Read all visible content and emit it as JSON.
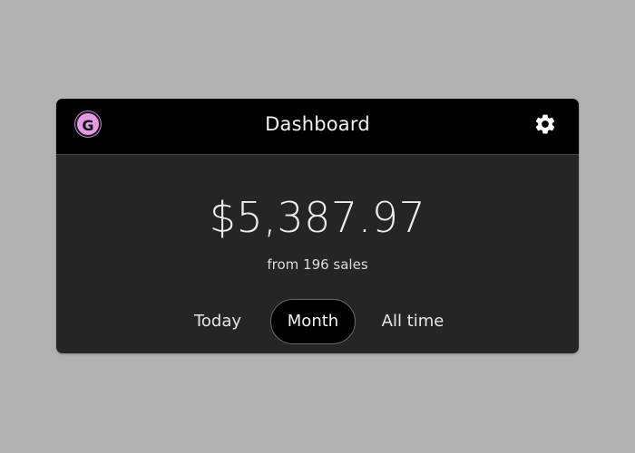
{
  "header": {
    "avatar_letter": "G",
    "title": "Dashboard",
    "settings_icon": "gear-icon"
  },
  "summary": {
    "amount": "$5,387.97",
    "subtitle": "from 196 sales"
  },
  "tabs": {
    "items": [
      {
        "label": "Today",
        "selected": false
      },
      {
        "label": "Month",
        "selected": true
      },
      {
        "label": "All time",
        "selected": false
      }
    ]
  },
  "colors": {
    "background": "#b1b1b1",
    "card": "#262525",
    "header": "#000000",
    "avatar": "#e49ae2"
  }
}
